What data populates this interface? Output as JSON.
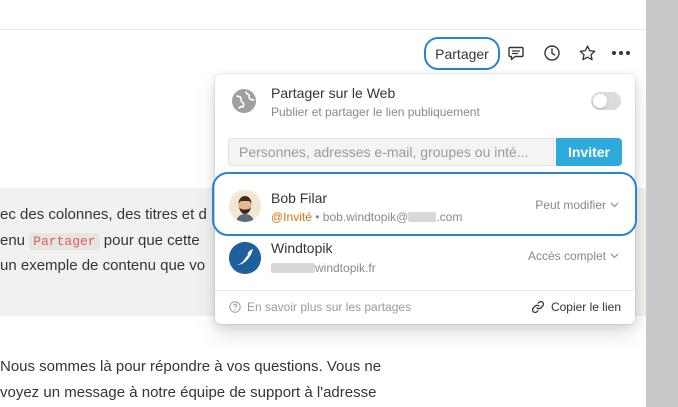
{
  "toolbar": {
    "share_label": "Partager",
    "icons": [
      "comment-icon",
      "history-icon",
      "star-icon",
      "more-icon"
    ]
  },
  "page": {
    "lines": [
      {
        "text_before": "ec des colonnes, des titres et d",
        "code": "",
        "text_after": ""
      },
      {
        "text_before": "enu ",
        "code": "Partager",
        "text_after": " pour que cette"
      },
      {
        "text_before": "un exemple de contenu que vo",
        "code": "",
        "text_after": ""
      },
      {
        "text_before": "Nous sommes là pour répondre à vos questions. Vous ne",
        "code": "",
        "text_after": ""
      },
      {
        "text_before": "voyez un message à notre équipe de support à l'adresse",
        "code": "",
        "text_after": ""
      }
    ]
  },
  "share_popup": {
    "web": {
      "title": "Partager sur le Web",
      "subtitle": "Publier et partager le lien publiquement",
      "enabled": false
    },
    "invite": {
      "placeholder": "Personnes, adresses e-mail, groupes ou inté...",
      "button_label": "Inviter"
    },
    "members": [
      {
        "name": "Bob Filar",
        "guest_label": "@Invité",
        "separator": "•",
        "email_prefix": "bob.windtopik@",
        "email_suffix": ".com",
        "permission": "Peut modifier"
      },
      {
        "name": "Windtopik",
        "domain_suffix": "windtopik.fr",
        "permission": "Accès complet"
      }
    ],
    "footer": {
      "help_text": "En savoir plus sur les partages",
      "copy_link_label": "Copier le lien"
    }
  },
  "colors": {
    "highlight": "#2a84d3",
    "invite_button": "#2eaadc",
    "guest": "#d9730d",
    "code_text": "#eb5757"
  }
}
